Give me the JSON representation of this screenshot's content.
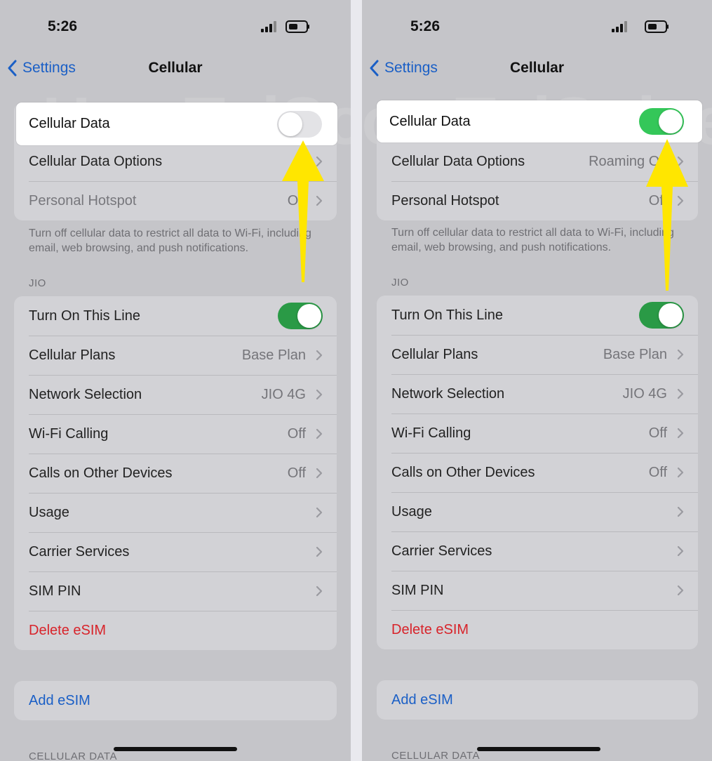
{
  "colors": {
    "accent": "#1a5fc6",
    "switch_on": "#34c759",
    "danger": "#d8232a",
    "arrow": "#ffe600"
  },
  "left": {
    "status": {
      "time": "5:26"
    },
    "nav": {
      "back_label": "Settings",
      "title": "Cellular"
    },
    "watermark": "HowToiSolve.com",
    "cellular_data": {
      "label": "Cellular Data",
      "on": false
    },
    "group1": [
      {
        "label": "Cellular Data Options",
        "value": ""
      },
      {
        "label": "Personal Hotspot",
        "value": "Off"
      }
    ],
    "footnote": "Turn off cellular data to restrict all data to Wi-Fi, including email, web browsing, and push notifications.",
    "section_jio": "JIO",
    "line_toggle": {
      "label": "Turn On This Line",
      "on": true
    },
    "group2": [
      {
        "label": "Cellular Plans",
        "value": "Base Plan"
      },
      {
        "label": "Network Selection",
        "value": "JIO 4G"
      },
      {
        "label": "Wi-Fi Calling",
        "value": "Off"
      },
      {
        "label": "Calls on Other Devices",
        "value": "Off"
      },
      {
        "label": "Usage",
        "value": ""
      },
      {
        "label": "Carrier Services",
        "value": ""
      },
      {
        "label": "SIM PIN",
        "value": ""
      }
    ],
    "delete_esim": "Delete eSIM",
    "add_esim": "Add eSIM",
    "section_bottom": "CELLULAR DATA"
  },
  "right": {
    "status": {
      "time": "5:26"
    },
    "nav": {
      "back_label": "Settings",
      "title": "Cellular"
    },
    "watermark": "HowToiSolve.com",
    "cellular_data": {
      "label": "Cellular Data",
      "on": true
    },
    "group1": [
      {
        "label": "Cellular Data Options",
        "value": "Roaming Off"
      },
      {
        "label": "Personal Hotspot",
        "value": "Off"
      }
    ],
    "footnote": "Turn off cellular data to restrict all data to Wi-Fi, including email, web browsing, and push notifications.",
    "section_jio": "JIO",
    "line_toggle": {
      "label": "Turn On This Line",
      "on": true
    },
    "group2": [
      {
        "label": "Cellular Plans",
        "value": "Base Plan"
      },
      {
        "label": "Network Selection",
        "value": "JIO 4G"
      },
      {
        "label": "Wi-Fi Calling",
        "value": "Off"
      },
      {
        "label": "Calls on Other Devices",
        "value": "Off"
      },
      {
        "label": "Usage",
        "value": ""
      },
      {
        "label": "Carrier Services",
        "value": ""
      },
      {
        "label": "SIM PIN",
        "value": ""
      }
    ],
    "delete_esim": "Delete eSIM",
    "add_esim": "Add eSIM",
    "section_bottom": "CELLULAR DATA"
  }
}
